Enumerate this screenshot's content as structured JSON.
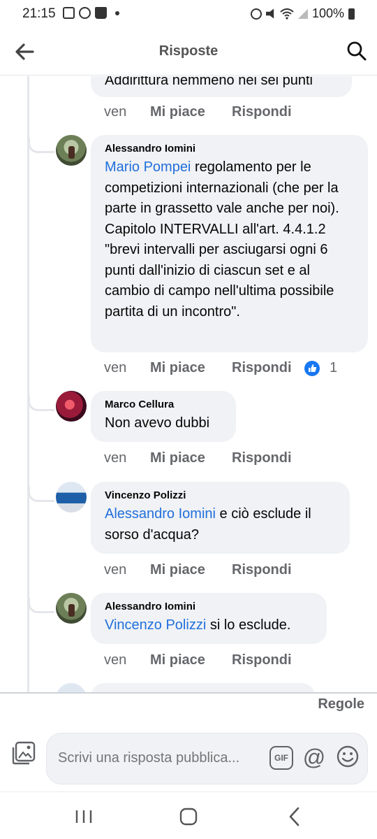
{
  "status_bar": {
    "time": "21:15",
    "battery": "100%"
  },
  "header": {
    "title": "Risposte"
  },
  "thread": {
    "top_partial": {
      "text": "Addirittura nemmeno nei sei punti",
      "time": "ven",
      "like_label": "Mi piace",
      "reply_label": "Rispondi"
    },
    "comments": [
      {
        "author": "Alessandro Iomini",
        "mention": "Mario Pompei",
        "text": " regolamento per le competizioni internazionali (che per la parte in grassetto vale anche per noi). Capitolo INTERVALLI all'art. 4.4.1.2 \"brevi intervalli per asciugarsi  ogni 6 punti dall'inizio di ciascun set e al cambio di campo nell'ultima possibile partita di un incontro\".",
        "time": "ven",
        "like_label": "Mi piace",
        "reply_label": "Rispondi",
        "reaction_count": "1"
      },
      {
        "author": "Marco Cellura",
        "mention": "",
        "text": "Non avevo dubbi",
        "time": "ven",
        "like_label": "Mi piace",
        "reply_label": "Rispondi"
      },
      {
        "author": "Vincenzo Polizzi",
        "mention": "Alessandro Iomini",
        "text": " e ciò esclude il sorso d'acqua?",
        "time": "ven",
        "like_label": "Mi piace",
        "reply_label": "Rispondi"
      },
      {
        "author": "Alessandro Iomini",
        "mention": "Vincenzo Polizzi",
        "text": " si lo esclude.",
        "time": "ven",
        "like_label": "Mi piace",
        "reply_label": "Rispondi"
      }
    ]
  },
  "footer": {
    "rules_link": "Regole",
    "composer_placeholder": "Scrivi una risposta pubblica...",
    "gif_label": "GIF",
    "at_label": "@"
  },
  "colors": {
    "mention": "#216fdb",
    "bubble": "#f0f2f5",
    "like_badge": "#1877f2"
  }
}
